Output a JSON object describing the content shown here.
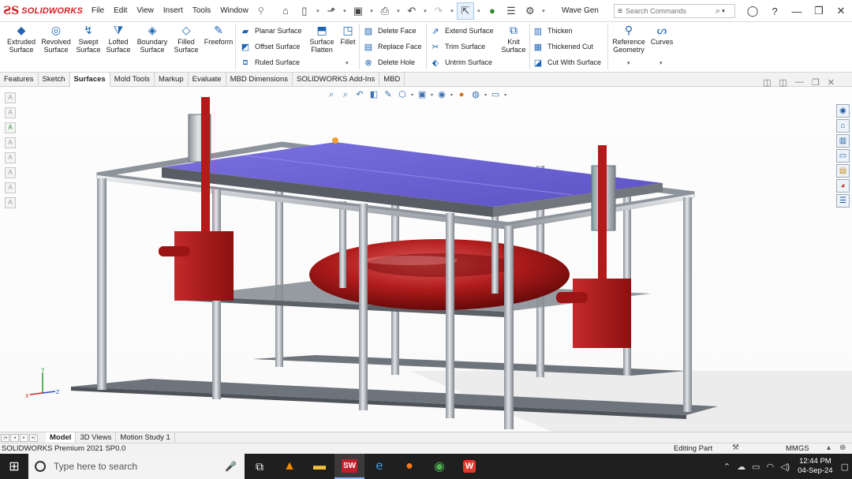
{
  "app": {
    "brand": "SOLIDWORKS",
    "document_title": "Wave Gen"
  },
  "menu": [
    "File",
    "Edit",
    "View",
    "Insert",
    "Tools",
    "Window"
  ],
  "search": {
    "placeholder": "Search Commands"
  },
  "ribbon": {
    "big_buttons": [
      {
        "label1": "Extruded",
        "label2": "Surface"
      },
      {
        "label1": "Revolved",
        "label2": "Surface"
      },
      {
        "label1": "Swept",
        "label2": "Surface"
      },
      {
        "label1": "Lofted",
        "label2": "Surface"
      },
      {
        "label1": "Boundary",
        "label2": "Surface"
      },
      {
        "label1": "Filled",
        "label2": "Surface"
      },
      {
        "label1": "Freeform",
        "label2": ""
      }
    ],
    "group2": [
      "Planar Surface",
      "Offset Surface",
      "Ruled Surface"
    ],
    "surface_flatten": {
      "label1": "Surface",
      "label2": "Flatten"
    },
    "fillet": "Fillet",
    "group3": [
      "Delete Face",
      "Replace Face",
      "Delete Hole"
    ],
    "group4": [
      "Extend Surface",
      "Trim Surface",
      "Untrim Surface"
    ],
    "knit_surface": {
      "label1": "Knit",
      "label2": "Surface"
    },
    "group5": [
      "Thicken",
      "Thickened Cut",
      "Cut With Surface"
    ],
    "reference_geometry": {
      "label1": "Reference",
      "label2": "Geometry"
    },
    "curves": "Curves"
  },
  "tabs": [
    "Features",
    "Sketch",
    "Surfaces",
    "Mold Tools",
    "Markup",
    "Evaluate",
    "MBD Dimensions",
    "SOLIDWORKS Add-Ins",
    "MBD"
  ],
  "active_tab": "Surfaces",
  "bottom_tabs": [
    "Model",
    "3D Views",
    "Motion Study 1"
  ],
  "status": {
    "product": "SOLIDWORKS Premium 2021 SP0.0",
    "mode": "Editing Part",
    "units": "MMGS"
  },
  "taskbar": {
    "search_placeholder": "Type here to search",
    "time": "12:44 PM",
    "date": "04-Sep-24"
  },
  "colors": {
    "brand_red": "#d21f26",
    "plate_blue": "#6a62d6",
    "torus_red": "#a81818",
    "frame_steel": "#b9bec4"
  }
}
